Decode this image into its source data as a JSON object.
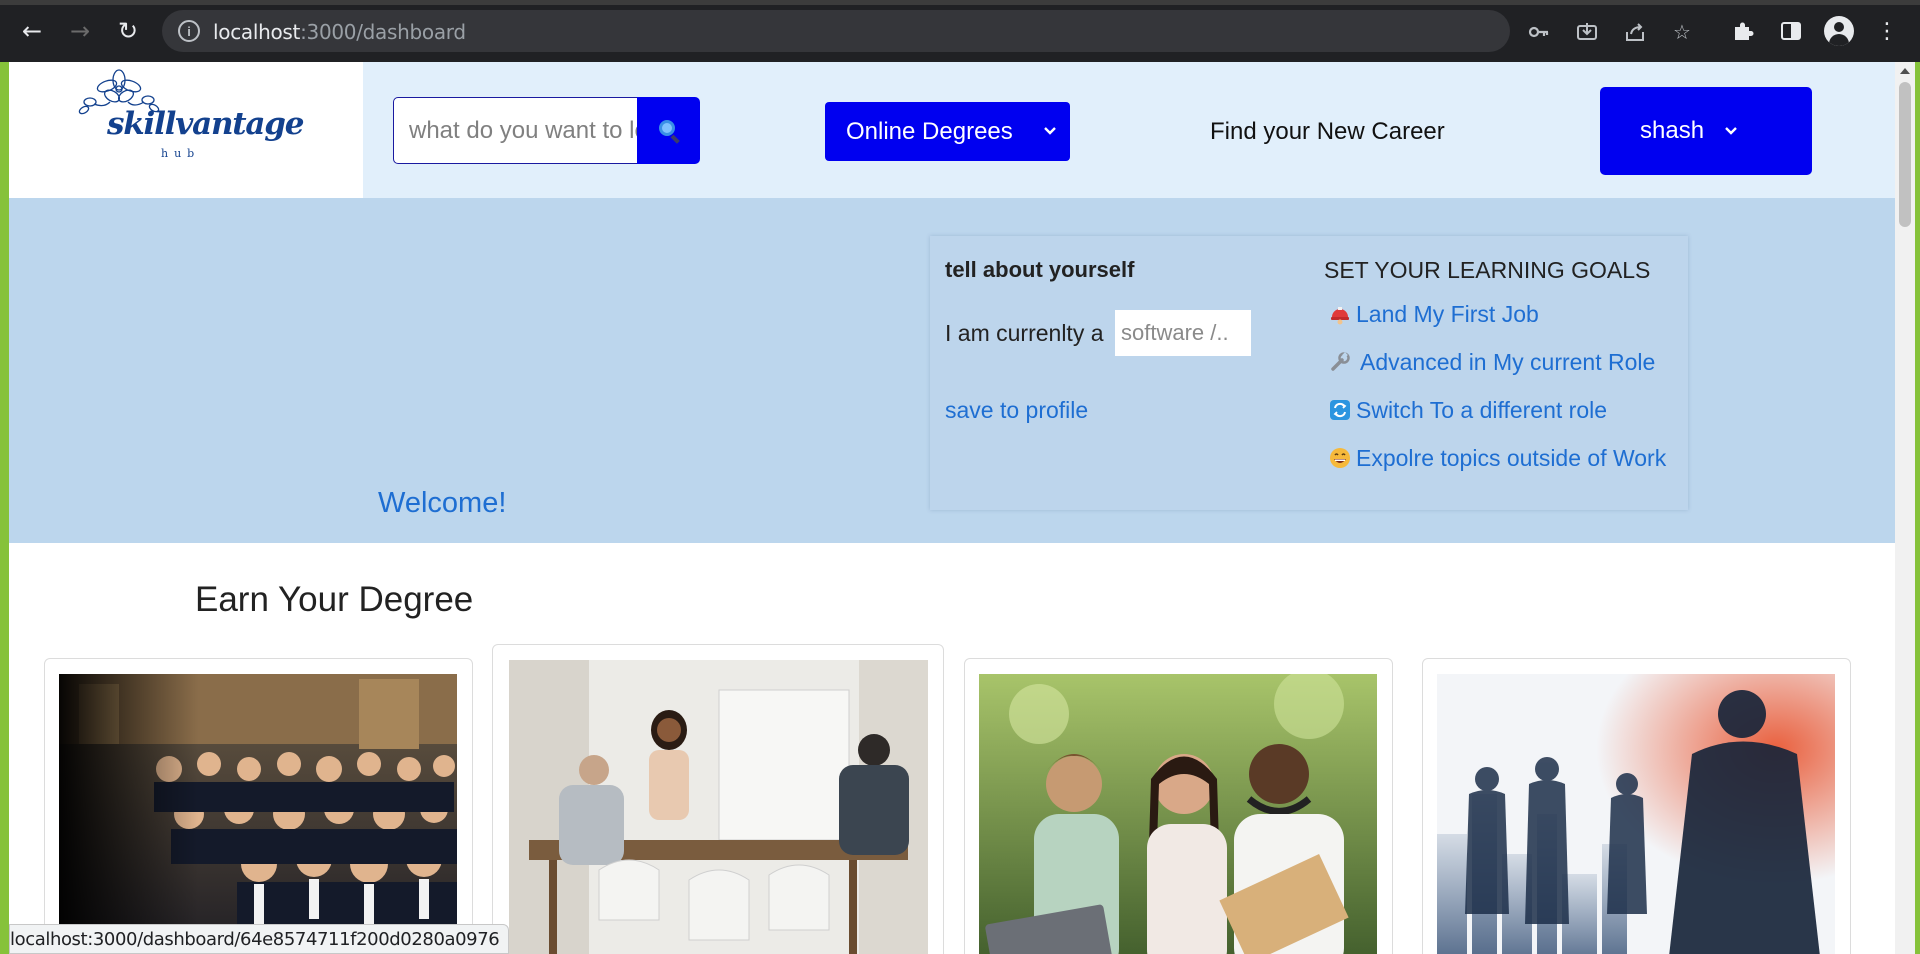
{
  "browser": {
    "url_host": "localhost",
    "url_path": ":3000/dashboard",
    "status_url": "localhost:3000/dashboard/64e8574711f200d0280a0976"
  },
  "header": {
    "logo_text": "skillvantage",
    "logo_sub": "hub",
    "search_placeholder": "what do you want to learn?",
    "degrees_label": "Online Degrees",
    "find_career": "Find your New Career",
    "user_name": "shash"
  },
  "hero": {
    "welcome": "Welcome!",
    "tell_title": "tell about yourself",
    "current_label": "I am currenlty a",
    "current_placeholder": "software /..",
    "save_link": "save to profile",
    "goals_title": "SET YOUR LEARNING GOALS",
    "goals": [
      {
        "icon": "helmet-icon",
        "label": "Land My First Job"
      },
      {
        "icon": "wrench-icon",
        "label": "Advanced in My current Role"
      },
      {
        "icon": "switch-arrows-icon",
        "label": "Switch To a different role"
      },
      {
        "icon": "smile-icon",
        "label": "Expolre topics outside of Work"
      }
    ]
  },
  "degrees": {
    "title": "Earn Your Degree",
    "cards": [
      {
        "image": "graduation-crowd-photo"
      },
      {
        "image": "office-meeting-photo"
      },
      {
        "image": "students-studying-photo"
      },
      {
        "image": "business-silhouettes-photo"
      }
    ]
  },
  "colors": {
    "primary_blue": "#0000f0",
    "header_bg": "#e1effb",
    "hero_bg": "#bcd6ed",
    "link_blue": "#1e6ed2",
    "logo_navy": "#13418e"
  }
}
